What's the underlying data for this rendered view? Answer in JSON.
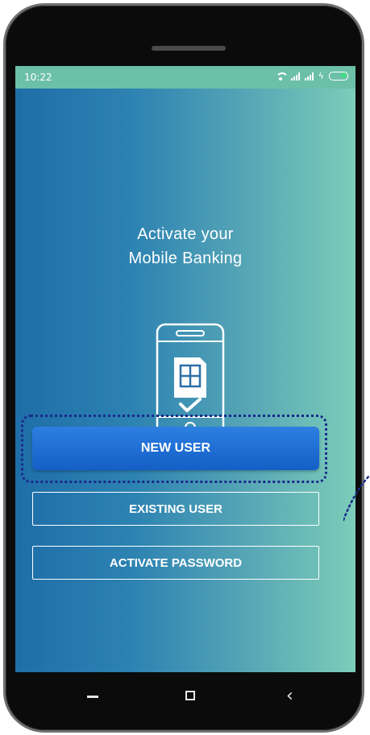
{
  "status_bar": {
    "time": "10:22",
    "icons": [
      "wifi-icon",
      "signal-icon",
      "signal-icon",
      "charging-icon",
      "battery-icon"
    ],
    "battery_color": "#38e07a"
  },
  "main": {
    "title_line1": "Activate your",
    "title_line2": "Mobile Banking",
    "illustration": "phone-sim-check-icon"
  },
  "buttons": {
    "new_user": "NEW USER",
    "existing_user": "EXISTING USER",
    "activate_password": "ACTIVATE PASSWORD"
  },
  "navbar": {
    "icons": [
      "back-icon",
      "home-icon",
      "recent-apps-icon"
    ],
    "recent_glyph": "‹"
  },
  "colors": {
    "accent": "#135fc6",
    "highlight_outline": "#1a2a8a",
    "status_bar": "#6cc0a8",
    "gradient_left": "#1e6ea8",
    "gradient_right": "#7ccdb9"
  }
}
